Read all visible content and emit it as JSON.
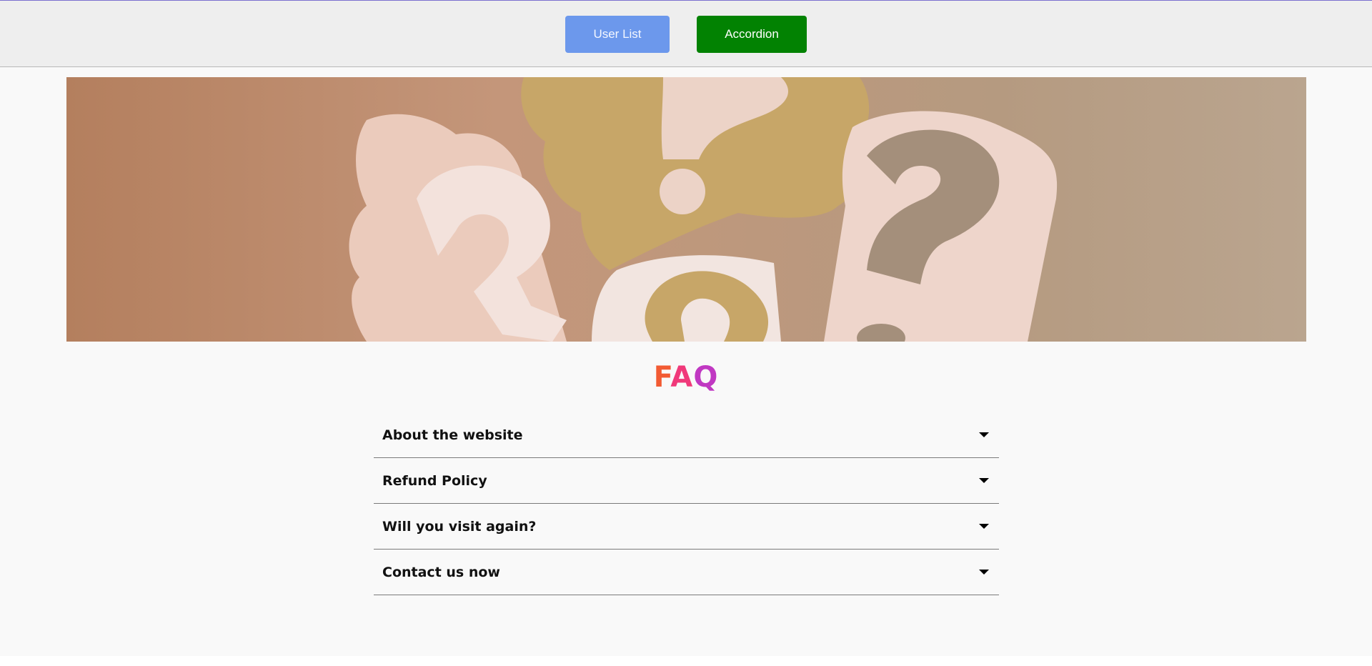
{
  "nav": {
    "user_list_label": "User List",
    "accordion_label": "Accordion"
  },
  "hero": {
    "image_subject": "paper question marks banner"
  },
  "faq": {
    "title_part1": "F",
    "title_part2": "A",
    "title_part3": "Q",
    "items": [
      {
        "label": "About the website"
      },
      {
        "label": "Refund Policy"
      },
      {
        "label": "Will you visit again?"
      },
      {
        "label": "Contact us now"
      }
    ]
  },
  "colors": {
    "user_list_button": "#6c98ec",
    "accordion_button": "#028202",
    "title_gradient": [
      "#f25b33",
      "#f0397a",
      "#c038c2"
    ]
  }
}
